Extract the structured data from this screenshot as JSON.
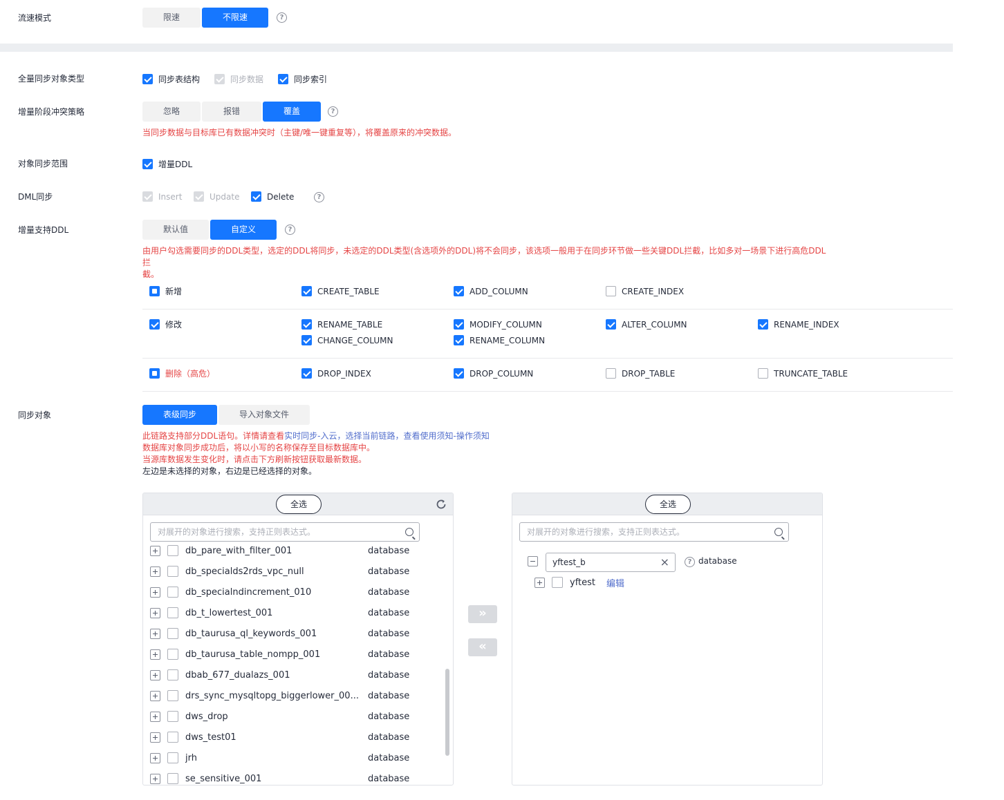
{
  "flow": {
    "label": "流速模式",
    "options": [
      "限速",
      "不限速"
    ],
    "active": 1
  },
  "full_sync": {
    "label": "全量同步对象类型",
    "options": [
      {
        "text": "同步表结构",
        "state": "checked"
      },
      {
        "text": "同步数据",
        "state": "disabled"
      },
      {
        "text": "同步索引",
        "state": "checked"
      }
    ]
  },
  "conflict": {
    "label": "增量阶段冲突策略",
    "options": [
      "忽略",
      "报错",
      "覆盖"
    ],
    "active": 2,
    "note": "当同步数据与目标库已有数据冲突时（主键/唯一键重复等），将覆盖原来的冲突数据。"
  },
  "scope": {
    "label": "对象同步范围",
    "option": "增量DDL"
  },
  "dml": {
    "label": "DML同步",
    "options": [
      {
        "text": "Insert",
        "state": "disabled"
      },
      {
        "text": "Update",
        "state": "disabled"
      },
      {
        "text": "Delete",
        "state": "checked"
      }
    ]
  },
  "ddl_support": {
    "label": "增量支持DDL",
    "options": [
      "默认值",
      "自定义"
    ],
    "active": 1,
    "note_line1": "由用户勾选需要同步的DDL类型，选定的DDL将同步，未选定的DDL类型(含选项外的DDL)将不会同步，该选项一般用于在同步环节做一些关键DDL拦截，比如多对一场景下进行高危DDL拦",
    "note_line2": "截。"
  },
  "ddl_groups": {
    "add": {
      "label": "新增",
      "items": [
        {
          "text": "CREATE_TABLE",
          "state": "checked"
        },
        {
          "text": "ADD_COLUMN",
          "state": "checked"
        },
        {
          "text": "CREATE_INDEX",
          "state": "unchecked"
        }
      ]
    },
    "modify": {
      "label": "修改",
      "items": [
        {
          "text": "RENAME_TABLE",
          "state": "checked"
        },
        {
          "text": "MODIFY_COLUMN",
          "state": "checked"
        },
        {
          "text": "ALTER_COLUMN",
          "state": "checked"
        },
        {
          "text": "RENAME_INDEX",
          "state": "checked"
        },
        {
          "text": "CHANGE_COLUMN",
          "state": "checked"
        },
        {
          "text": "RENAME_COLUMN",
          "state": "checked"
        }
      ]
    },
    "delete": {
      "label": "删除（高危）",
      "items": [
        {
          "text": "DROP_INDEX",
          "state": "checked"
        },
        {
          "text": "DROP_COLUMN",
          "state": "checked"
        },
        {
          "text": "DROP_TABLE",
          "state": "unchecked"
        },
        {
          "text": "TRUNCATE_TABLE",
          "state": "unchecked"
        }
      ]
    }
  },
  "sync_obj": {
    "label": "同步对象",
    "options": [
      "表级同步",
      "导入对象文件"
    ],
    "active": 0,
    "note1_prefix": "此链路支持部分DDL语句。详情请查看",
    "note1_link": "实时同步-入云，选择当前链路，查看使用须知-操作须知",
    "note2": "数据库对象同步成功后，将以小写的名称保存至目标数据库中。",
    "note3": "当源库数据发生变化时，请点击下方刷新按钮获取最新数据。",
    "note4": "左边是未选择的对象，右边是已经选择的对象。"
  },
  "left_panel": {
    "select_all": "全选",
    "search_placeholder": "对展开的对象进行搜索，支持正则表达式。",
    "rows": [
      {
        "name": "db_pare_with_filter_001",
        "type": "database"
      },
      {
        "name": "db_specialds2rds_vpc_null",
        "type": "database"
      },
      {
        "name": "db_specialndincrement_010",
        "type": "database"
      },
      {
        "name": "db_t_lowertest_001",
        "type": "database"
      },
      {
        "name": "db_taurusa_ql_keywords_001",
        "type": "database"
      },
      {
        "name": "db_taurusa_table_nompp_001",
        "type": "database"
      },
      {
        "name": "dbab_677_dualazs_001",
        "type": "database"
      },
      {
        "name": "drs_sync_mysqltopg_biggerlower_00...",
        "type": "database"
      },
      {
        "name": "dws_drop",
        "type": "database"
      },
      {
        "name": "dws_test01",
        "type": "database"
      },
      {
        "name": "jrh",
        "type": "database"
      },
      {
        "name": "se_sensitive_001",
        "type": "database"
      }
    ]
  },
  "right_panel": {
    "select_all": "全选",
    "search_placeholder": "对展开的对象进行搜索，支持正则表达式。",
    "db_name": "yftest_b",
    "db_type": "database",
    "child_name": "yftest",
    "child_action": "编辑"
  },
  "transfer": {
    "move_right": "»",
    "move_left": "«"
  },
  "colors": {
    "accent": "#1677ff",
    "warning_text": "#e54545",
    "link": "#526ecc"
  }
}
